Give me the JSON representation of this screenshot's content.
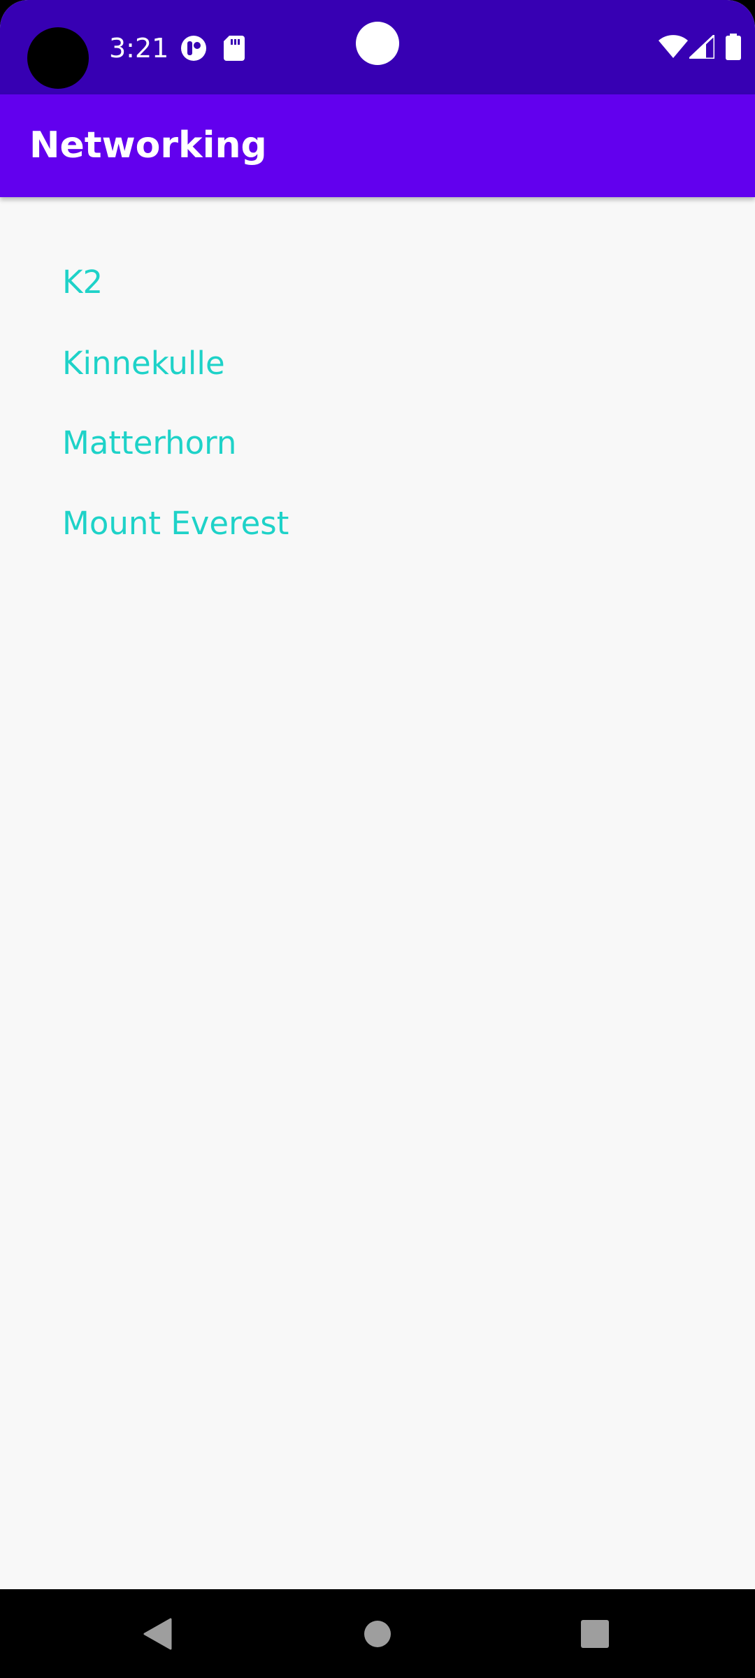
{
  "status_bar": {
    "time": "3:21",
    "background_color": "#3700B3",
    "icons": [
      "app-indicator-icon",
      "sd-card-icon",
      "wifi-icon",
      "cell-signal-icon",
      "battery-icon"
    ]
  },
  "app_bar": {
    "title": "Networking",
    "background_color": "#6200EE"
  },
  "list": {
    "text_color": "#1ED2C8",
    "items": [
      {
        "label": "K2"
      },
      {
        "label": "Kinnekulle"
      },
      {
        "label": "Matterhorn"
      },
      {
        "label": "Mount Everest"
      }
    ]
  },
  "nav_bar": {
    "buttons": [
      "back-icon",
      "home-icon",
      "recents-icon"
    ]
  }
}
